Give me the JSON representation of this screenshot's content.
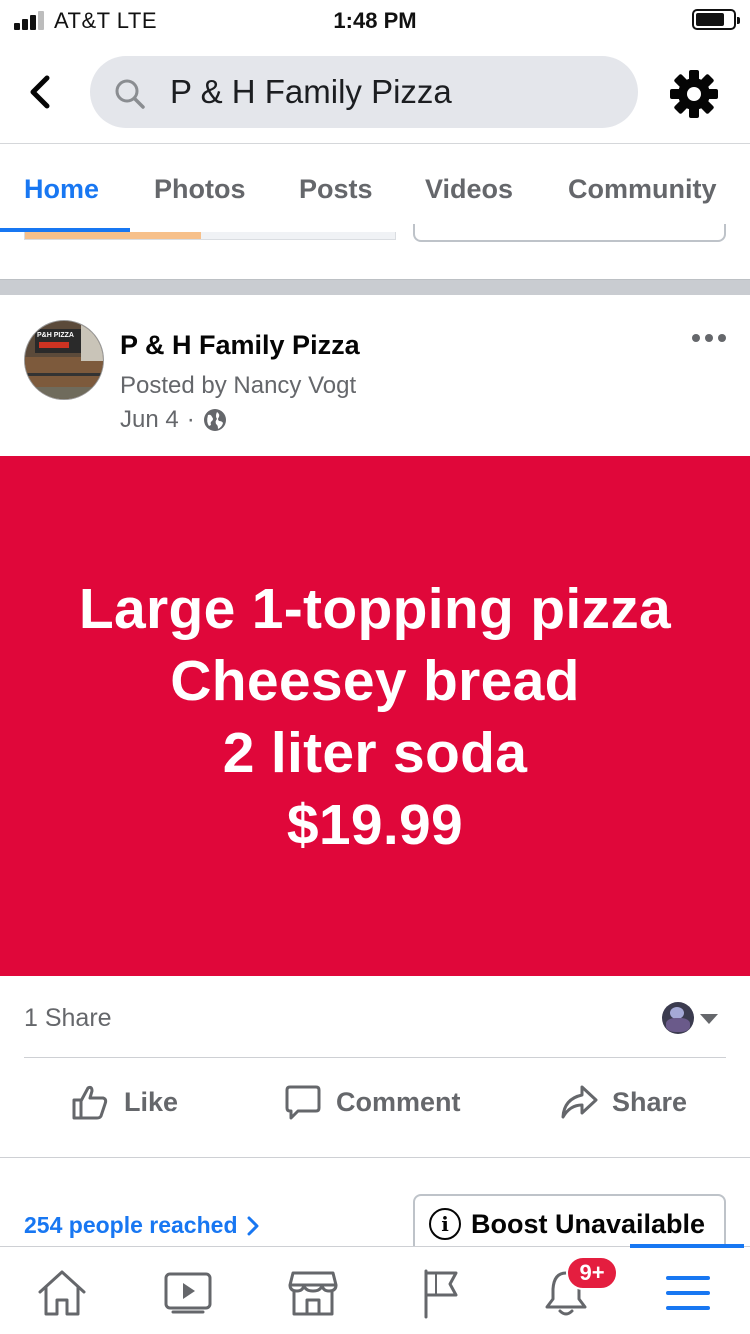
{
  "status_bar": {
    "carrier": "AT&T   LTE",
    "time": "1:48 PM"
  },
  "header": {
    "search_value": "P & H Family Pizza",
    "icons": [
      "back-chevron-icon",
      "search-icon",
      "gear-icon"
    ]
  },
  "tabs": [
    {
      "label": "Home",
      "active": true
    },
    {
      "label": "Photos"
    },
    {
      "label": "Posts"
    },
    {
      "label": "Videos"
    },
    {
      "label": "Community"
    }
  ],
  "post": {
    "page_name": "P & H Family Pizza",
    "posted_by": "Posted by Nancy Vogt",
    "date": "Jun 4",
    "separator": "·",
    "privacy_icon": "globe-icon",
    "promo_lines": [
      "Large 1-topping pizza",
      "Cheesey bread",
      "2 liter soda",
      "$19.99"
    ],
    "promo_color": "#e0073a",
    "share_count": "1 Share",
    "actions": {
      "like": "Like",
      "comment": "Comment",
      "share": "Share"
    },
    "reach": "254 people reached",
    "boost": "Boost Unavailable"
  },
  "bottom_nav": {
    "items": [
      "home-icon",
      "watch-icon",
      "marketplace-icon",
      "pages-flag-icon",
      "notifications-bell-icon",
      "menu-icon"
    ],
    "notification_badge": "9+",
    "active_item": "menu-icon"
  },
  "colors": {
    "accent": "#1877f2",
    "badge": "#e41e3f"
  }
}
